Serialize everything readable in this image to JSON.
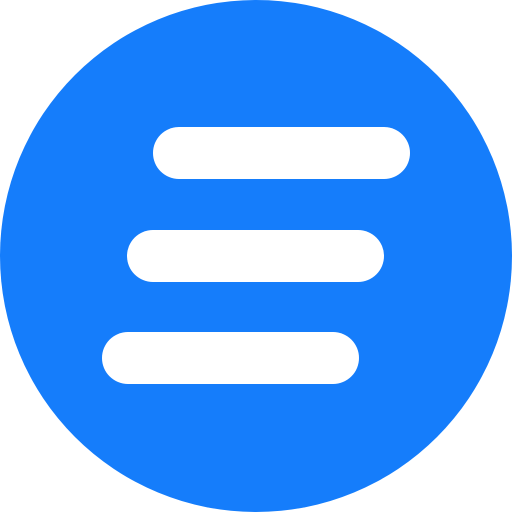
{
  "icon": {
    "name": "menu-icon",
    "background_color": "#157DFB",
    "bar_color": "#FFFFFF",
    "bar_count": 3
  }
}
